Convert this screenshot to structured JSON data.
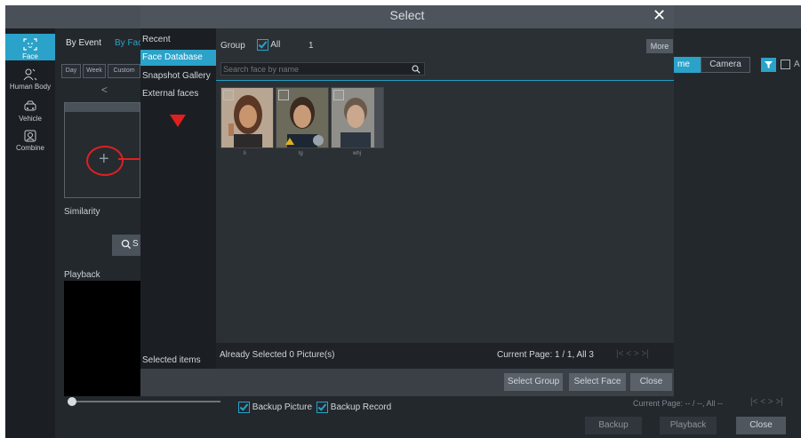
{
  "left_nav": {
    "items": [
      {
        "label": "Face",
        "icon": "face-icon",
        "active": true
      },
      {
        "label": "Human Body",
        "icon": "human-body-icon",
        "active": false
      },
      {
        "label": "Vehicle",
        "icon": "vehicle-icon",
        "active": false
      },
      {
        "label": "Combine",
        "icon": "combine-icon",
        "active": false
      }
    ]
  },
  "background": {
    "tabs": {
      "by_event": "By Event",
      "by_face": "By Fac"
    },
    "range_pills": [
      "Day",
      "Week",
      "Custom"
    ],
    "prev_arrow": "<",
    "similarity_label": "Similarity",
    "search_btn_fragment": "S",
    "playback_label": "Playback",
    "filter_tabs": {
      "name": "me",
      "camera": "Camera"
    },
    "filter_partial": "A",
    "backup_picture": "Backup Picture",
    "backup_record": "Backup Record",
    "current_page": "Current Page: -- / --, All --",
    "buttons": {
      "backup": "Backup",
      "playback": "Playback",
      "close": "Close"
    },
    "accent": "#2aa2c9",
    "annotation_color": "#e0201f"
  },
  "modal": {
    "title": "Select",
    "close_glyph": "✕",
    "side_items": [
      "Recent",
      "Face Database",
      "Snapshot Gallery",
      "External faces"
    ],
    "side_active_index": 1,
    "selected_items_label": "Selected items",
    "group_label": "Group",
    "all_label": "All",
    "group_count": "1",
    "more_label": "More",
    "search_placeholder": "Search face by name",
    "faces": [
      {
        "name": "li"
      },
      {
        "name": "lg"
      },
      {
        "name": "whj"
      }
    ],
    "already_selected": "Already Selected 0 Picture(s)",
    "current_page": "Current Page: 1 / 1, All 3",
    "buttons": {
      "select_group": "Select Group",
      "select_face": "Select Face",
      "close": "Close"
    }
  }
}
